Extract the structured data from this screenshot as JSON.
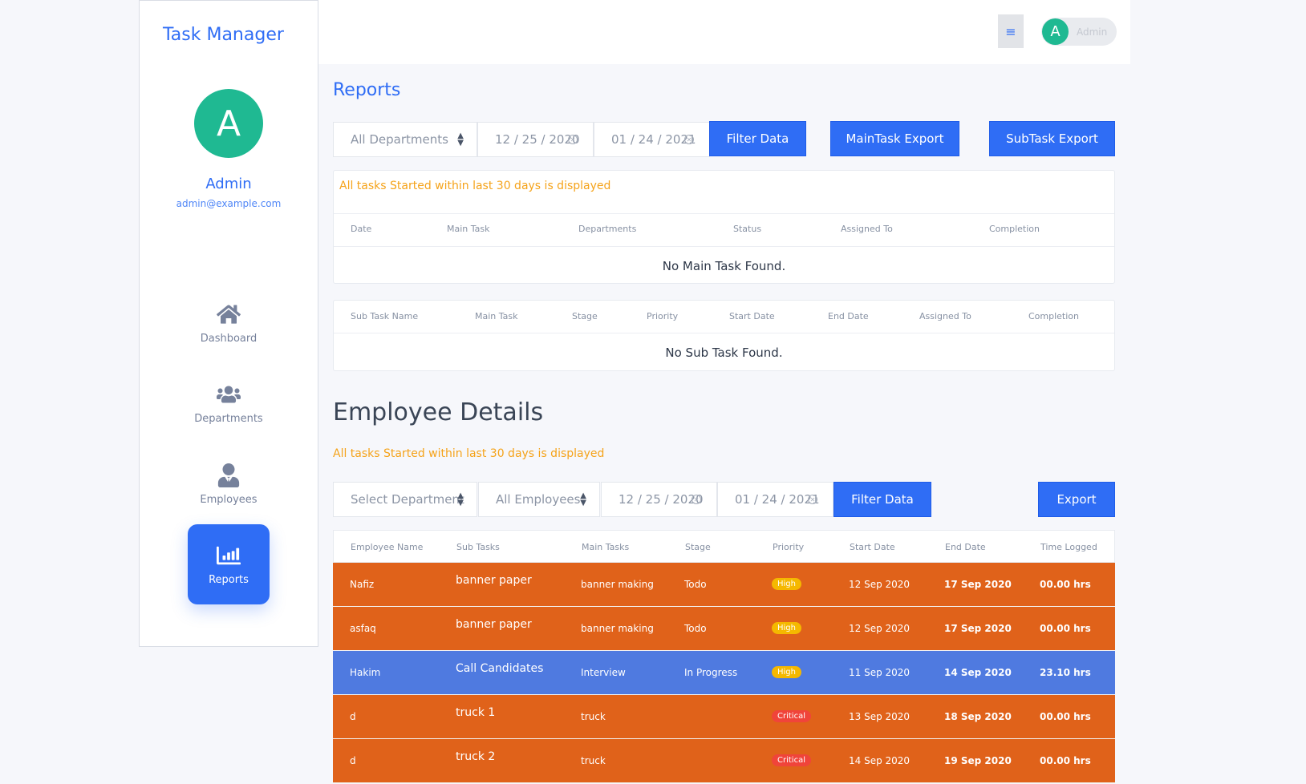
{
  "sidebar": {
    "brand": "Task Manager",
    "avatar_letter": "A",
    "user_name": "Admin",
    "user_email": "admin@example.com",
    "nav": [
      {
        "label": "Dashboard",
        "icon": "home-icon"
      },
      {
        "label": "Departments",
        "icon": "users-icon"
      },
      {
        "label": "Employees",
        "icon": "user-tie-icon"
      },
      {
        "label": "Reports",
        "icon": "chart-bar-icon",
        "active": true
      }
    ]
  },
  "header": {
    "menu_icon": "≡",
    "user_letter": "A",
    "user_name": "Admin"
  },
  "reports": {
    "title": "Reports",
    "department_select": "All Departments",
    "date_from": "12 / 25 / 2020",
    "date_to": "01 / 24 / 2021",
    "filter_label": "Filter Data",
    "maintask_export_label": "MainTask Export",
    "subtask_export_label": "SubTask Export",
    "notice": "All tasks Started within last 30 days is displayed",
    "main_columns": [
      "Date",
      "Main Task",
      "Departments",
      "Status",
      "Assigned To",
      "Completion"
    ],
    "main_empty": "No Main Task Found.",
    "sub_columns": [
      "Sub Task Name",
      "Main Task",
      "Stage",
      "Priority",
      "Start Date",
      "End Date",
      "Assigned To",
      "Completion"
    ],
    "sub_empty": "No Sub Task Found."
  },
  "employees": {
    "title": "Employee Details",
    "notice": "All tasks Started within last 30 days is displayed",
    "department_select": "Select Department",
    "employee_select": "All Employees",
    "date_from": "12 / 25 / 2020",
    "date_to": "01 / 24 / 2021",
    "filter_label": "Filter Data",
    "export_label": "Export",
    "columns": [
      "Employee Name",
      "Sub Tasks",
      "Main Tasks",
      "Stage",
      "Priority",
      "Start Date",
      "End Date",
      "Time Logged"
    ],
    "rows": [
      {
        "name": "Nafiz",
        "sub": "banner paper",
        "main": "banner making",
        "stage": "Todo",
        "priority": "High",
        "start": "12 Sep 2020",
        "end": "17 Sep 2020",
        "time": "00.00 hrs",
        "color": "#e0621a"
      },
      {
        "name": "asfaq",
        "sub": "banner paper",
        "main": "banner making",
        "stage": "Todo",
        "priority": "High",
        "start": "12 Sep 2020",
        "end": "17 Sep 2020",
        "time": "00.00 hrs",
        "color": "#e0621a"
      },
      {
        "name": "Hakim",
        "sub": "Call Candidates",
        "main": "Interview",
        "stage": "In Progress",
        "priority": "High",
        "start": "11 Sep 2020",
        "end": "14 Sep 2020",
        "time": "23.10 hrs",
        "color": "#4f7ae0"
      },
      {
        "name": "d",
        "sub": "truck 1",
        "main": "truck",
        "stage": "",
        "priority": "Critical",
        "start": "13 Sep 2020",
        "end": "18 Sep 2020",
        "time": "00.00 hrs",
        "color": "#e0621a"
      },
      {
        "name": "d",
        "sub": "truck 2",
        "main": "truck",
        "stage": "",
        "priority": "Critical",
        "start": "14 Sep 2020",
        "end": "19 Sep 2020",
        "time": "00.00 hrs",
        "color": "#e0621a"
      }
    ]
  },
  "colors": {
    "primary": "#2f6df5",
    "accent_green": "#1fb992",
    "notice": "#f5a31a",
    "row_orange": "#e0621a",
    "row_blue": "#4f7ae0",
    "badge_high": "#f5b800",
    "badge_critical": "#f0443a"
  }
}
